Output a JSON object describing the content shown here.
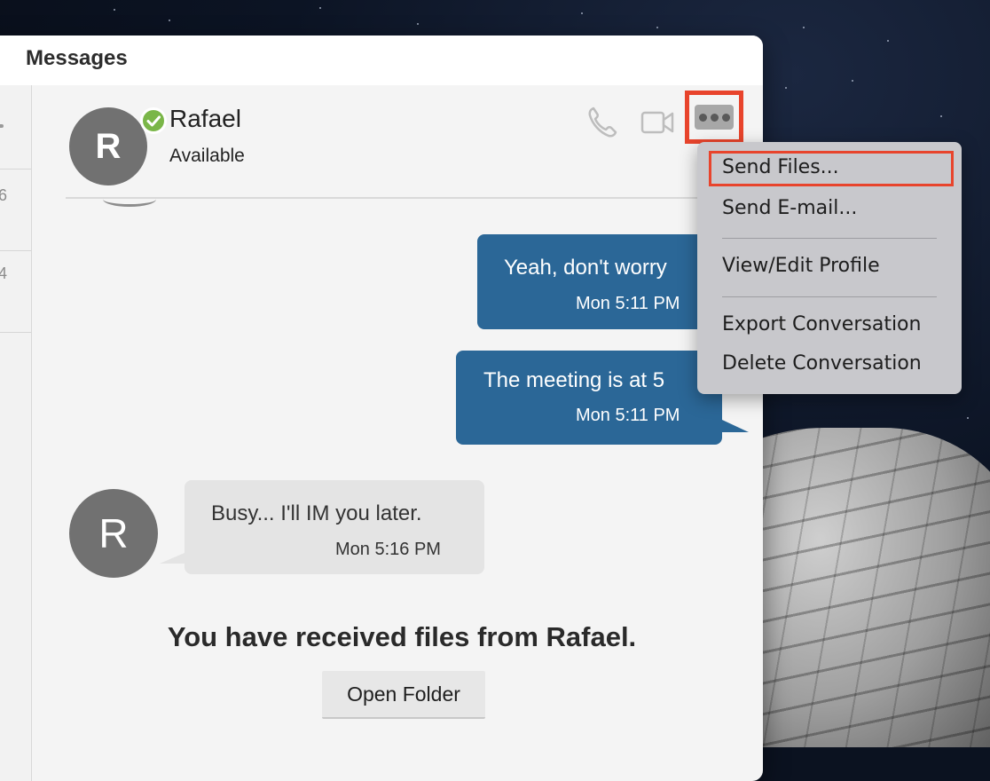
{
  "window": {
    "title": "Messages"
  },
  "sidebar": {
    "numbers": [
      "6",
      "4"
    ]
  },
  "contact": {
    "initial": "R",
    "name": "Rafael",
    "status": "Available"
  },
  "messages": [
    {
      "direction": "out",
      "text": "Yeah, don't worry",
      "time": "Mon 5:11 PM"
    },
    {
      "direction": "out",
      "text": "The meeting is at 5",
      "time": "Mon 5:11 PM"
    },
    {
      "direction": "in",
      "sender_initial": "R",
      "text": "Busy... I'll IM you later.",
      "time": "Mon 5:16 PM"
    }
  ],
  "received_files": {
    "notice": "You have received files from Rafael.",
    "button_label": "Open Folder"
  },
  "menu": {
    "items": [
      "Send Files...",
      "Send E-mail...",
      "View/Edit Profile",
      "Export Conversation",
      "Delete Conversation"
    ],
    "highlighted": "Send Files..."
  },
  "icons": {
    "phone": "phone-icon",
    "video": "video-camera-icon",
    "more": "more-options-icon",
    "status": "checkmark-icon"
  },
  "colors": {
    "outgoing_bubble": "#2b6797",
    "incoming_bubble": "#e4e4e4",
    "available_status": "#7ab648",
    "highlight": "#e8442c"
  }
}
